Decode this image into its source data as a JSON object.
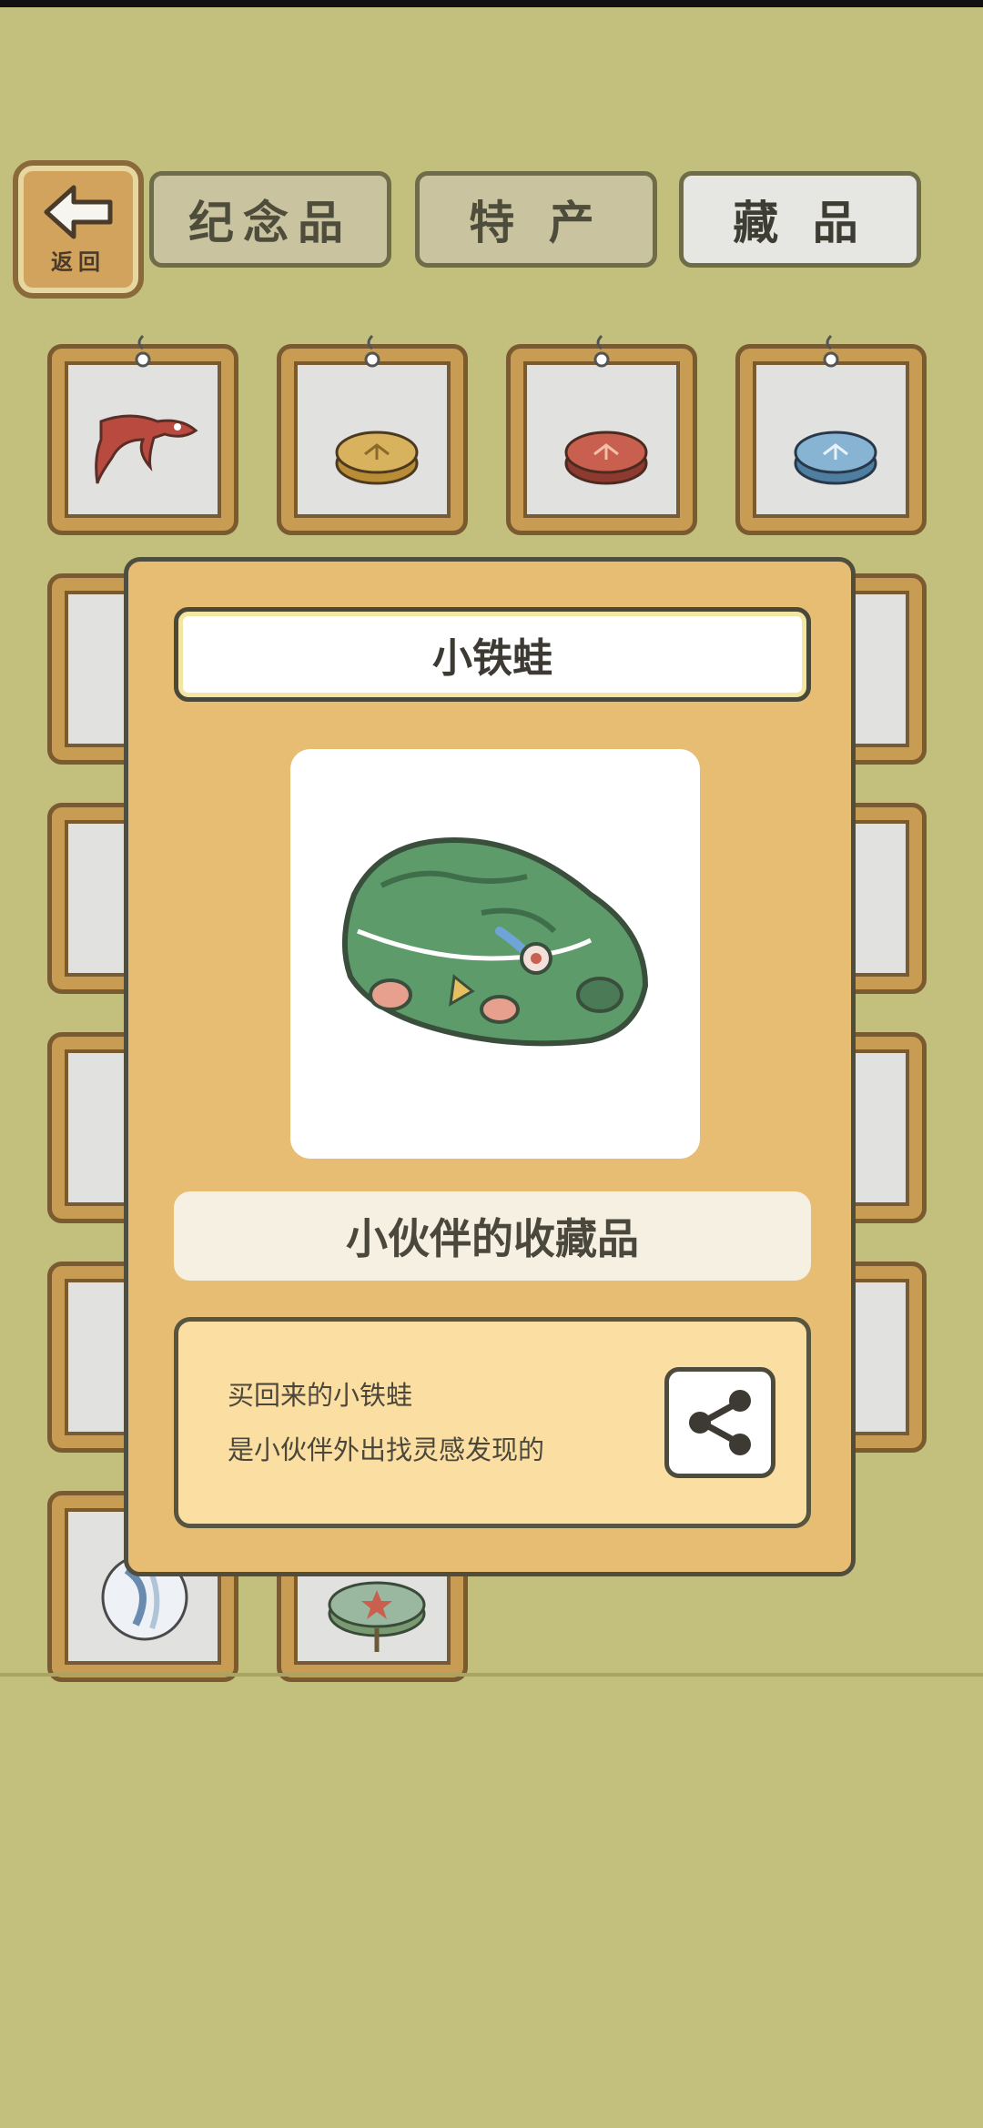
{
  "back": {
    "label": "返回"
  },
  "tabs": [
    {
      "label": "纪念品",
      "active": false
    },
    {
      "label": "特 产",
      "active": false
    },
    {
      "label": "藏 品",
      "active": true
    }
  ],
  "grid_items": [
    {
      "icon": "red-tadpole-icon"
    },
    {
      "icon": "yellow-coin-icon"
    },
    {
      "icon": "red-coin-icon"
    },
    {
      "icon": "blue-coin-icon"
    },
    {
      "icon": "marble-icon"
    },
    {
      "icon": "green-top-icon"
    }
  ],
  "modal": {
    "title": "小铁蛙",
    "item_icon": "tin-frog-icon",
    "category": "小伙伴的收藏品",
    "description": {
      "line1": "买回来的小铁蛙",
      "line2": "是小伙伴外出找灵感发现的"
    },
    "share_icon": "share-icon"
  },
  "colors": {
    "background": "#c3bf7c",
    "modal_bg": "#e7bd73",
    "wood": "#c89c52",
    "frog_green": "#5e9b6a"
  }
}
